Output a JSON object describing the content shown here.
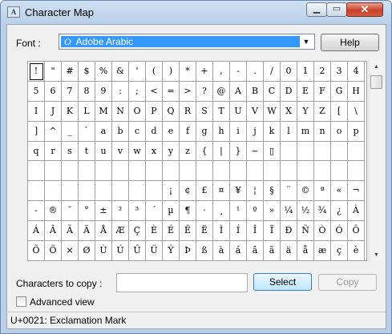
{
  "window": {
    "title": "Character Map",
    "icon_label": "A",
    "minimize_glyph": "▁",
    "maximize_glyph": "▭",
    "close_glyph": "✕"
  },
  "font": {
    "label": "Font :",
    "selected": "Adobe Arabic",
    "font_icon": "O",
    "dropdown_arrow": "▼"
  },
  "help_button": "Help",
  "grid": {
    "selected_index": 0,
    "chars": [
      "!",
      "\"",
      "#",
      "$",
      "%",
      "&",
      "'",
      "(",
      ")",
      "*",
      "+",
      ",",
      "-",
      ".",
      "/",
      "0",
      "1",
      "2",
      "3",
      "4",
      "5",
      "6",
      "7",
      "8",
      "9",
      ":",
      ";",
      "<",
      "=",
      ">",
      "?",
      "@",
      "A",
      "B",
      "C",
      "D",
      "E",
      "F",
      "G",
      "H",
      "I",
      "J",
      "K",
      "L",
      "M",
      "N",
      "O",
      "P",
      "Q",
      "R",
      "S",
      "T",
      "U",
      "V",
      "W",
      "X",
      "Y",
      "Z",
      "[",
      "\\",
      "]",
      "^",
      "_",
      "`",
      "a",
      "b",
      "c",
      "d",
      "e",
      "f",
      "g",
      "h",
      "i",
      "j",
      "k",
      "l",
      "m",
      "n",
      "o",
      "p",
      "q",
      "r",
      "s",
      "t",
      "u",
      "v",
      "w",
      "x",
      "y",
      "z",
      "{",
      "|",
      "}",
      "~",
      "▯",
      "",
      "",
      "",
      "",
      "",
      "",
      "",
      "",
      "",
      "",
      "",
      "",
      "",
      "",
      "",
      "",
      "",
      "",
      "",
      "",
      "",
      "",
      "",
      "",
      "",
      "",
      "",
      "",
      "",
      "",
      "",
      "",
      "",
      "¡",
      "¢",
      "£",
      "¤",
      "¥",
      "¦",
      "§",
      "¨",
      "©",
      "ª",
      "«",
      "¬",
      "-",
      "®",
      "¯",
      "°",
      "±",
      "²",
      "³",
      "´",
      "µ",
      "¶",
      "·",
      "¸",
      "¹",
      "º",
      "»",
      "¼",
      "½",
      "¾",
      "¿",
      "À",
      "Á",
      "Â",
      "Ã",
      "Ä",
      "Å",
      "Æ",
      "Ç",
      "È",
      "É",
      "Ê",
      "Ë",
      "Ì",
      "Í",
      "Î",
      "Ï",
      "Ð",
      "Ñ",
      "Ò",
      "Ó",
      "Ô",
      "Õ",
      "Ö",
      "×",
      "Ø",
      "Ù",
      "Ú",
      "Û",
      "Ü",
      "Ý",
      "Þ",
      "ß",
      "à",
      "á",
      "â",
      "ã",
      "ä",
      "å",
      "æ",
      "ç",
      "è"
    ]
  },
  "scrollbar": {
    "up_glyph": "▲",
    "down_glyph": "▼"
  },
  "copy": {
    "label": "Characters to copy :",
    "value": "",
    "select_button": "Select",
    "copy_button": "Copy"
  },
  "advanced_view": {
    "label": "Advanced view",
    "checked": false
  },
  "status": "U+0021: Exclamation Mark"
}
